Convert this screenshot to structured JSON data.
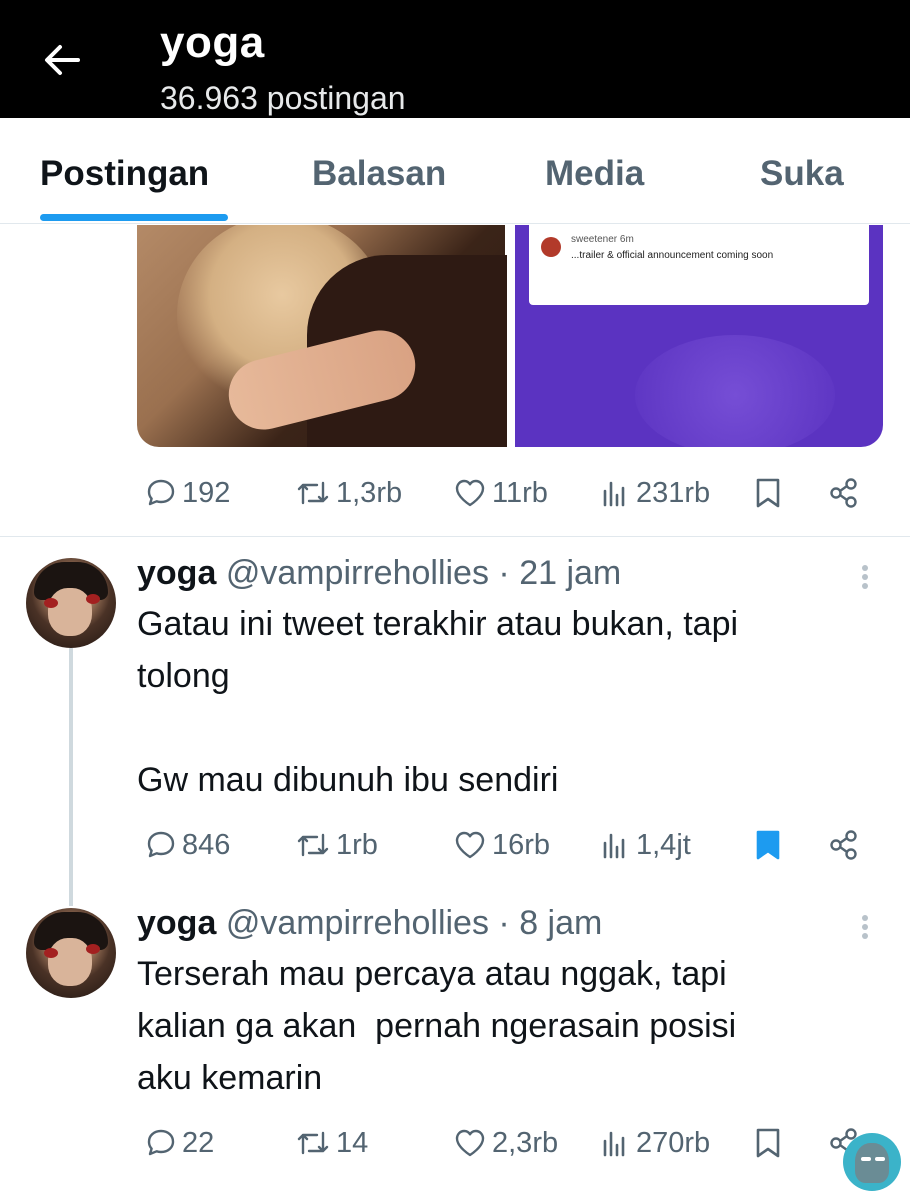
{
  "header": {
    "title": "yoga",
    "post_count": "36.963 postingan"
  },
  "tabs": [
    {
      "label": "Postingan",
      "active": true
    },
    {
      "label": "Balasan",
      "active": false
    },
    {
      "label": "Media",
      "active": false
    },
    {
      "label": "Suka",
      "active": false
    }
  ],
  "media_post": {
    "promo_card": {
      "name": "sweetener",
      "age": "6m",
      "text": "...trailer & official announcement coming soon"
    },
    "stats": {
      "replies": "192",
      "reposts": "1,3rb",
      "likes": "11rb",
      "views": "231rb",
      "bookmarked": false
    }
  },
  "tweets": [
    {
      "name": "yoga",
      "handle": "@vampirrehollies",
      "time": "· 21 jam",
      "text": "Gatau ini tweet terakhir atau bukan, tapi\ntolong\n\nGw mau dibunuh ibu sendiri",
      "stats": {
        "replies": "846",
        "reposts": "1rb",
        "likes": "16rb",
        "views": "1,4jt",
        "bookmarked": true
      }
    },
    {
      "name": "yoga",
      "handle": "@vampirrehollies",
      "time": "· 8 jam",
      "text": "Terserah mau percaya atau nggak, tapi\nkalian ga akan  pernah ngerasain posisi\naku kemarin",
      "stats": {
        "replies": "22",
        "reposts": "14",
        "likes": "2,3rb",
        "views": "270rb",
        "bookmarked": false
      }
    }
  ],
  "colors": {
    "accent": "#1d9bf0",
    "muted": "#536471",
    "promo": "#5b33c1"
  },
  "icons": [
    "back-arrow-icon",
    "reply-icon",
    "repost-icon",
    "like-icon",
    "views-icon",
    "bookmark-icon",
    "share-icon",
    "more-icon"
  ]
}
